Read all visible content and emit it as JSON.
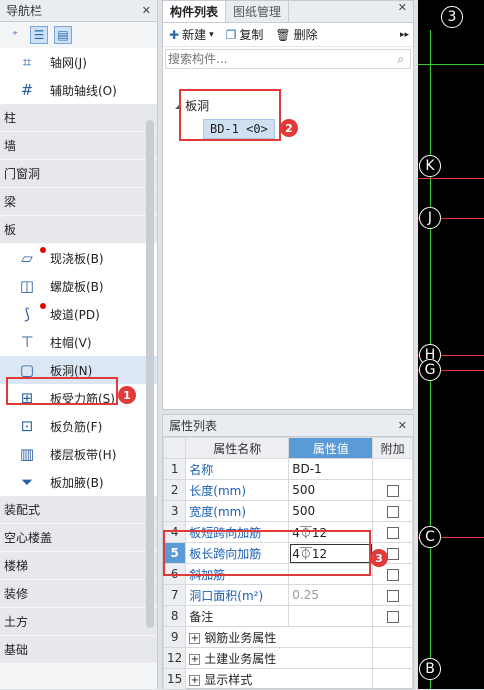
{
  "nav": {
    "title": "导航栏",
    "tool_icons": [
      "plus-icon",
      "list-icon",
      "grid-list-icon"
    ],
    "grid_items": [
      {
        "label": "轴网(J)",
        "icon": "axis-grid-icon"
      },
      {
        "label": "辅助轴线(O)",
        "icon": "aux-axis-icon"
      }
    ],
    "categories_top": [
      "柱",
      "墙",
      "门窗洞",
      "梁",
      "板"
    ],
    "board_items": [
      {
        "label": "现浇板(B)",
        "icon": "cast-slab-icon",
        "dot": true
      },
      {
        "label": "螺旋板(B)",
        "icon": "spiral-slab-icon",
        "dot": false
      },
      {
        "label": "坡道(PD)",
        "icon": "ramp-icon",
        "dot": true
      },
      {
        "label": "柱帽(V)",
        "icon": "column-cap-icon",
        "dot": false
      },
      {
        "label": "板洞(N)",
        "icon": "slab-hole-icon",
        "dot": false
      },
      {
        "label": "板受力筋(S)",
        "icon": "slab-rebar-icon",
        "dot": false
      },
      {
        "label": "板负筋(F)",
        "icon": "negative-rebar-icon",
        "dot": false
      },
      {
        "label": "楼层板带(H)",
        "icon": "slab-strip-icon",
        "dot": false
      },
      {
        "label": "板加腋(B)",
        "icon": "slab-haunch-icon",
        "dot": false
      }
    ],
    "categories_bottom": [
      "装配式",
      "空心楼盖",
      "楼梯",
      "装修",
      "土方",
      "基础"
    ]
  },
  "components": {
    "tabs": [
      "构件列表",
      "图纸管理"
    ],
    "toolbar": {
      "new": "新建",
      "copy": "复制",
      "delete": "删除",
      "more": "▸▸"
    },
    "search_placeholder": "搜索构件...",
    "tree_root": "板洞",
    "tree_leaf": "BD-1 <0>"
  },
  "attr": {
    "title": "属性列表",
    "headers": [
      "属性名称",
      "属性值",
      "附加"
    ],
    "rows": [
      {
        "num": "1",
        "name": "名称",
        "value": "BD-1",
        "check": false
      },
      {
        "num": "2",
        "name": "长度(mm)",
        "value": "500",
        "check": true
      },
      {
        "num": "3",
        "name": "宽度(mm)",
        "value": "500",
        "check": true
      },
      {
        "num": "4",
        "name": "板短跨向加筋",
        "value": "4⏁12",
        "check": true
      },
      {
        "num": "5",
        "name": "板长跨向加筋",
        "value": "4⏁12",
        "check": true
      },
      {
        "num": "6",
        "name": "斜加筋",
        "value": "",
        "check": true
      },
      {
        "num": "7",
        "name": "洞口面积(m²)",
        "value": "0.25",
        "check": true
      },
      {
        "num": "8",
        "name": "备注",
        "value": "",
        "check": true
      },
      {
        "num": "9",
        "name": "钢筋业务属性",
        "value": "",
        "check": false
      },
      {
        "num": "12",
        "name": "土建业务属性",
        "value": "",
        "check": false
      },
      {
        "num": "15",
        "name": "显示样式",
        "value": "",
        "check": false
      }
    ]
  },
  "badges": [
    "1",
    "2",
    "3"
  ],
  "canvas_axes": [
    "3",
    "K",
    "J",
    "H",
    "G",
    "C",
    "B"
  ]
}
